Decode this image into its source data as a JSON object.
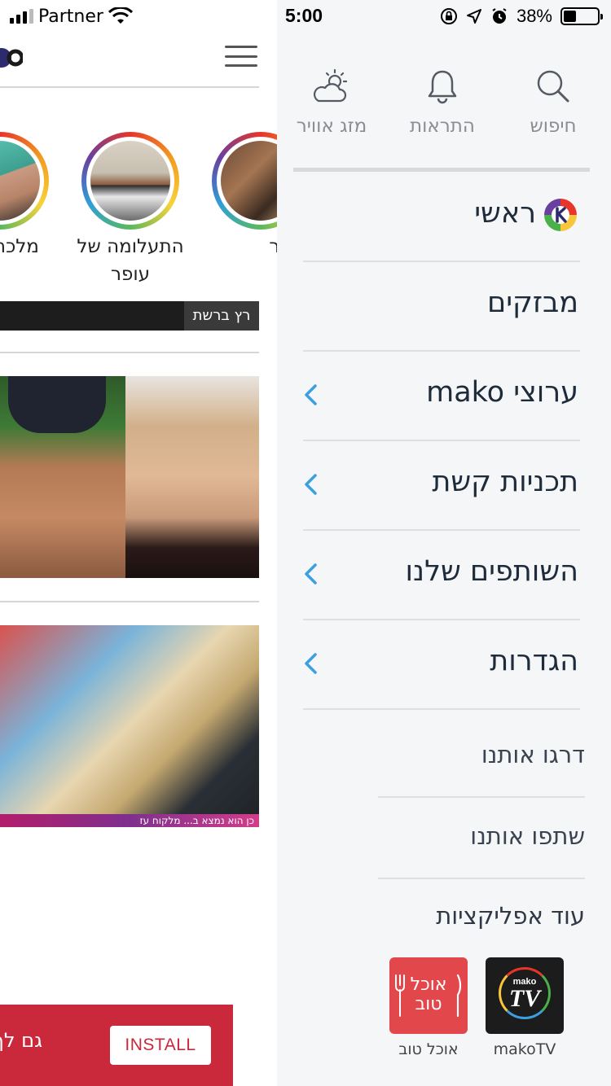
{
  "status_bar": {
    "carrier": "Partner",
    "time": "5:00",
    "battery": "38%",
    "battery_level": 0.38
  },
  "left_page": {
    "stories": [
      {
        "label": "מלכה"
      },
      {
        "label": "התעלומה של עופר"
      },
      {
        "label": "יות גבר"
      }
    ],
    "banner_tag": "רץ ברשת",
    "card_caption": "כן הוא נמצא ב... מלקוח עז",
    "install_bar": {
      "text": "גם לך",
      "button": "INSTALL"
    }
  },
  "drawer": {
    "top_actions": [
      {
        "label": "חיפוש",
        "icon": "search-icon"
      },
      {
        "label": "התראות",
        "icon": "bell-icon"
      },
      {
        "label": "מזג אוויר",
        "icon": "weather-icon"
      }
    ],
    "menu": [
      {
        "label": "ראשי",
        "chevron": false,
        "icon": "mako-logo-icon"
      },
      {
        "label": "מבזקים",
        "chevron": false
      },
      {
        "label": "ערוצי mako",
        "chevron": true
      },
      {
        "label": "תכניות קשת",
        "chevron": true
      },
      {
        "label": "השותפים שלנו",
        "chevron": true
      },
      {
        "label": "הגדרות",
        "chevron": true
      }
    ],
    "secondary": [
      {
        "label": "דרגו אותנו"
      },
      {
        "label": "שתפו אותנו"
      },
      {
        "label": "עוד אפליקציות"
      }
    ],
    "apps": [
      {
        "label": "makoTV",
        "icon_text_top": "mako",
        "icon_text_main": "TV"
      },
      {
        "label": "אוכל טוב",
        "icon_text_main": "אוכל טוב"
      }
    ]
  },
  "colors": {
    "accent_blue": "#3b9fe0",
    "install_red": "#c9293a",
    "menu_text": "#1e2b3a"
  }
}
